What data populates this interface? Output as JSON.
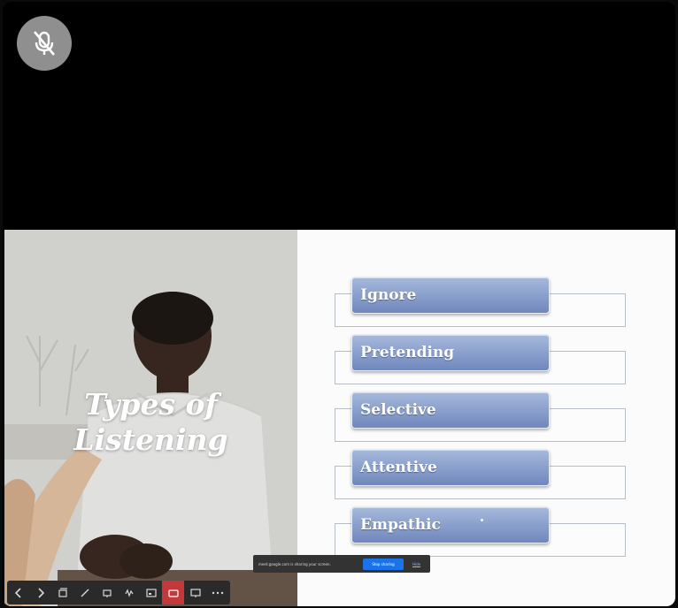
{
  "slide": {
    "title_line1": "Types of",
    "title_line2": "Listening",
    "items": [
      {
        "label": "Ignore"
      },
      {
        "label": "Pretending"
      },
      {
        "label": "Selective"
      },
      {
        "label": "Attentive"
      },
      {
        "label": "Empathic"
      }
    ]
  },
  "share_bar": {
    "message": "meet.google.com is sharing your screen.",
    "stop_label": "Stop sharing",
    "hide_label": "Hide"
  },
  "toolbar": {
    "buttons": [
      {
        "icon": "chevron-left-icon"
      },
      {
        "icon": "chevron-right-icon"
      },
      {
        "icon": "slides-icon"
      },
      {
        "icon": "pen-icon"
      },
      {
        "icon": "view-icon"
      },
      {
        "icon": "audio-icon"
      },
      {
        "icon": "subtitles-icon"
      },
      {
        "icon": "camera-icon"
      },
      {
        "icon": "screen-icon"
      },
      {
        "icon": "more-icon"
      }
    ]
  },
  "colors": {
    "pill_top": "#a7b9dc",
    "pill_bottom": "#7187bd",
    "active_tool": "#c4373b",
    "stop_button": "#1a73e8"
  }
}
